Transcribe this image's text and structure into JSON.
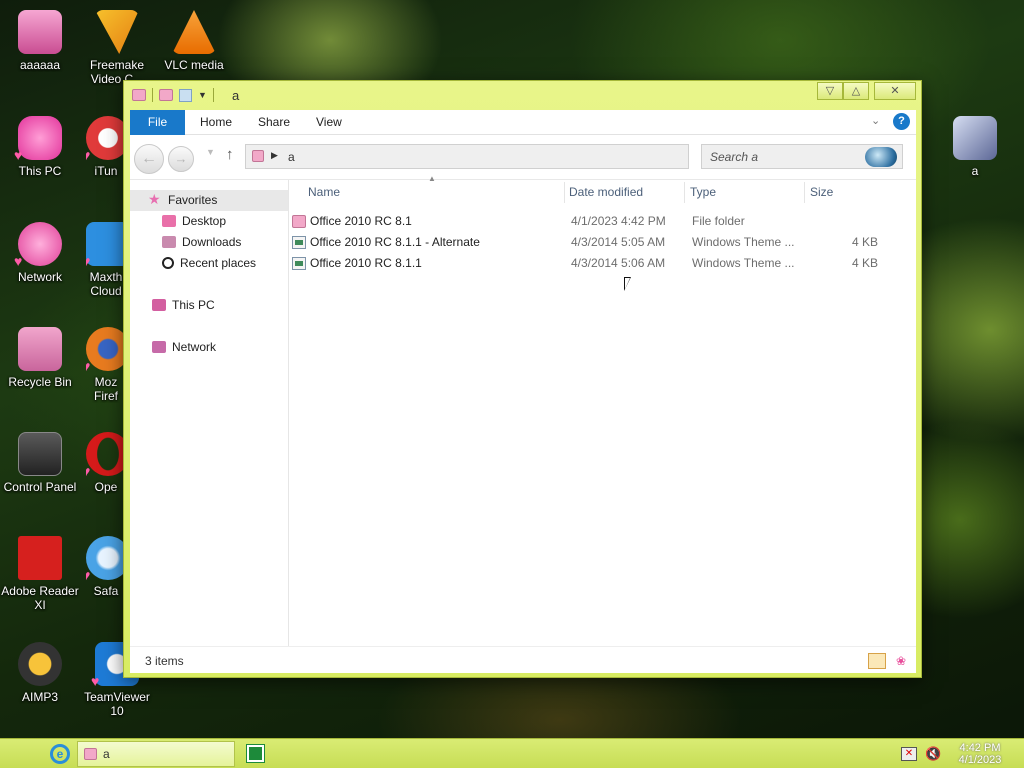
{
  "desktop": {
    "icons": [
      {
        "label": "aaaaaa",
        "icon": "pink-doll-icon",
        "color": "#e86cab"
      },
      {
        "label": "This PC",
        "icon": "this-pc-icon",
        "color": "#f25fb5"
      },
      {
        "label": "Network",
        "icon": "network-icon",
        "color": "#ee6fb8"
      },
      {
        "label": "Recycle Bin",
        "icon": "recycle-bin-icon",
        "color": "#e274b0"
      },
      {
        "label": "Control Panel",
        "icon": "control-panel-icon",
        "color": "#3d3d3d"
      },
      {
        "label": "Adobe Reader XI",
        "icon": "adobe-reader-icon",
        "color": "#d6201e"
      },
      {
        "label": "AIMP3",
        "icon": "aimp-icon",
        "color": "#f0b82a"
      },
      {
        "label": "Freemake Video C...",
        "icon": "freemake-icon",
        "color": "#f6a81d"
      },
      {
        "label": "iTun",
        "icon": "itunes-icon",
        "color": "#e03a3a"
      },
      {
        "label": "Maxth Cloud",
        "icon": "maxthon-icon",
        "color": "#2d8fe0"
      },
      {
        "label": "Moz Firef",
        "icon": "firefox-icon",
        "color": "#e87b1f"
      },
      {
        "label": "Ope",
        "icon": "opera-icon",
        "color": "#d51a1a"
      },
      {
        "label": "Safa",
        "icon": "safari-icon",
        "color": "#4aa3e6"
      },
      {
        "label": "TeamViewer 10",
        "icon": "teamviewer-icon",
        "color": "#1e7bd6"
      },
      {
        "label": "VLC media",
        "icon": "vlc-icon",
        "color": "#f28c00"
      },
      {
        "label": "a",
        "icon": "folder-icon",
        "color": "#9aa4c8"
      }
    ]
  },
  "window": {
    "title": "a",
    "accent": "#1979ca",
    "frame_color": "#dceb6d",
    "ribbon_tabs": [
      "File",
      "Home",
      "Share",
      "View"
    ],
    "address_path": "a",
    "search_placeholder": "Search a",
    "nav_pane": {
      "favorites": "Favorites",
      "desktop": "Desktop",
      "downloads": "Downloads",
      "recent": "Recent places",
      "this_pc": "This PC",
      "network": "Network"
    },
    "columns": [
      "Name",
      "Date modified",
      "Type",
      "Size"
    ],
    "files": [
      {
        "name": "Office 2010 RC 8.1",
        "date": "4/1/2023 4:42 PM",
        "type": "File folder",
        "size": "",
        "icon": "folder-icon"
      },
      {
        "name": "Office 2010 RC 8.1.1 - Alternate",
        "date": "4/3/2014 5:05 AM",
        "type": "Windows Theme ...",
        "size": "4 KB",
        "icon": "theme-file-icon"
      },
      {
        "name": "Office 2010 RC 8.1.1",
        "date": "4/3/2014 5:06 AM",
        "type": "Windows Theme ...",
        "size": "4 KB",
        "icon": "theme-file-icon"
      }
    ],
    "status": "3 items"
  },
  "taskbar": {
    "task_label": "a",
    "time": "4:42 PM",
    "date": "4/1/2023"
  }
}
